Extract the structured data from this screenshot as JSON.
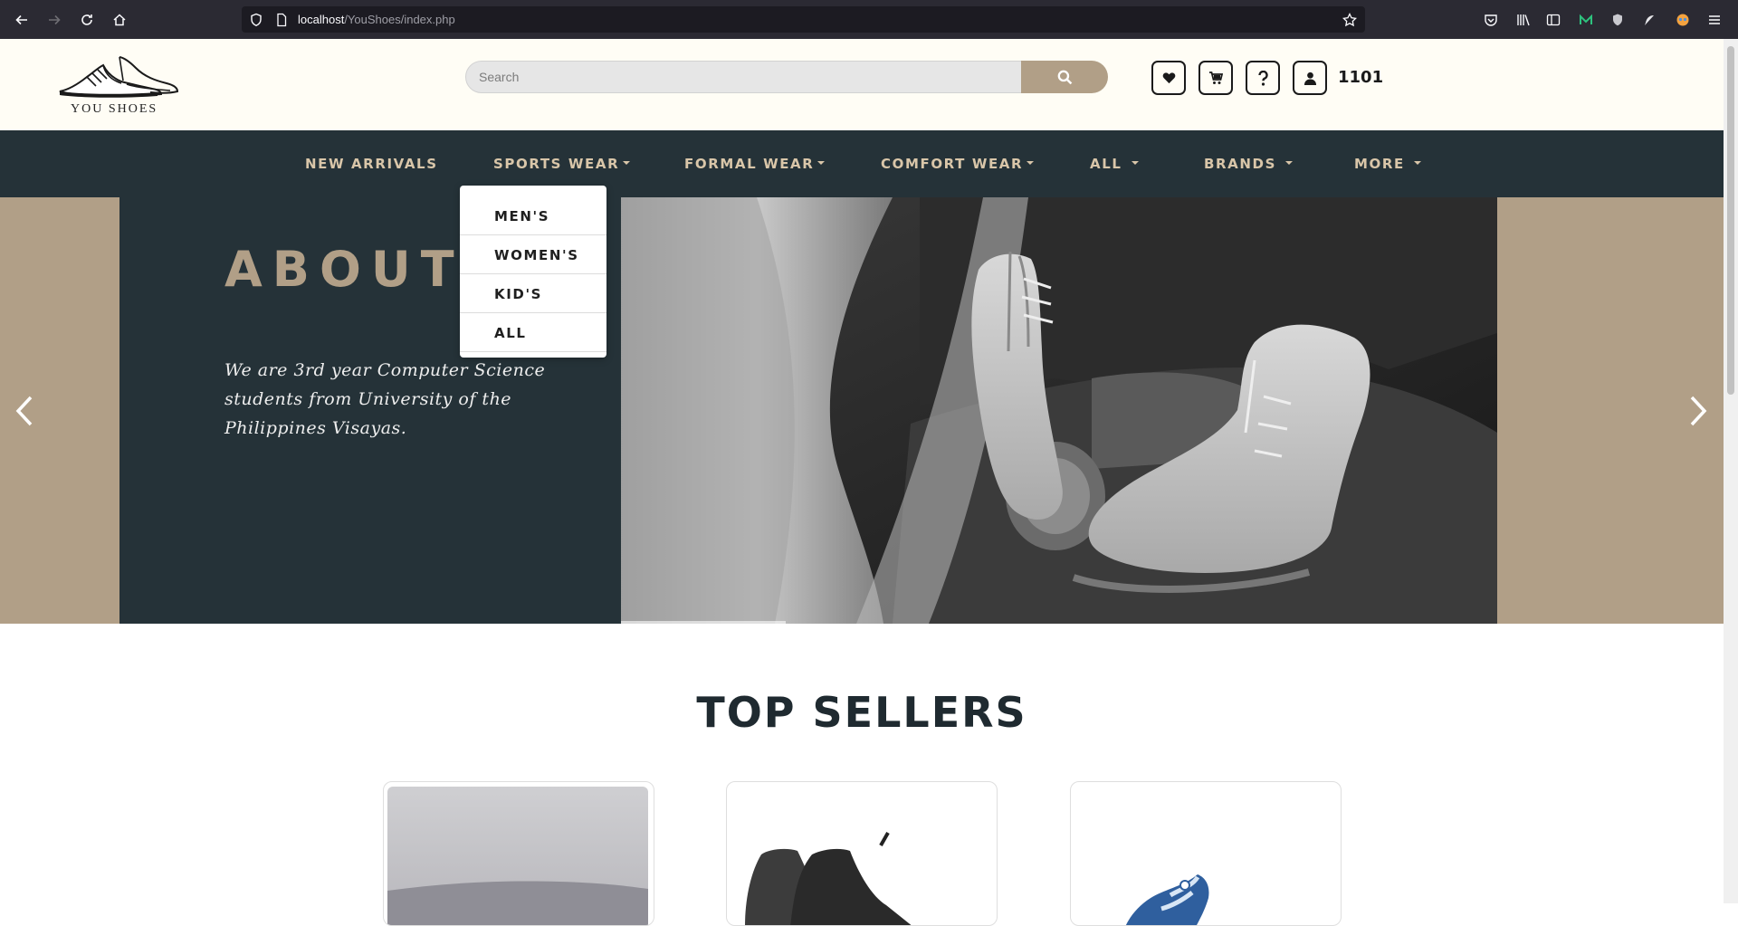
{
  "browser": {
    "url_host": "localhost",
    "url_path": "/YouShoes/index.php"
  },
  "header": {
    "logo_text": "YOU SHOES",
    "search_placeholder": "Search",
    "user_number": "1101"
  },
  "nav": {
    "items": [
      {
        "label": "NEW ARRIVALS",
        "dropdown": false
      },
      {
        "label": "SPORTS WEAR",
        "dropdown": true
      },
      {
        "label": "FORMAL WEAR",
        "dropdown": true
      },
      {
        "label": "COMFORT WEAR",
        "dropdown": true
      },
      {
        "label": "ALL",
        "dropdown": true
      },
      {
        "label": "BRANDS",
        "dropdown": true
      },
      {
        "label": "MORE",
        "dropdown": true
      }
    ]
  },
  "dropdown": {
    "items": [
      "MEN'S",
      "WOMEN'S",
      "KID'S",
      "ALL"
    ]
  },
  "hero": {
    "title": "ABOUT",
    "text": "We are 3rd year Computer Science students from University of the Philippines Visayas."
  },
  "top_sellers": {
    "title": "TOP SELLERS"
  },
  "colors": {
    "accent": "#b19f87",
    "dark": "#253238",
    "nav_text": "#d9c6a9",
    "header_bg": "#fffdf5"
  }
}
